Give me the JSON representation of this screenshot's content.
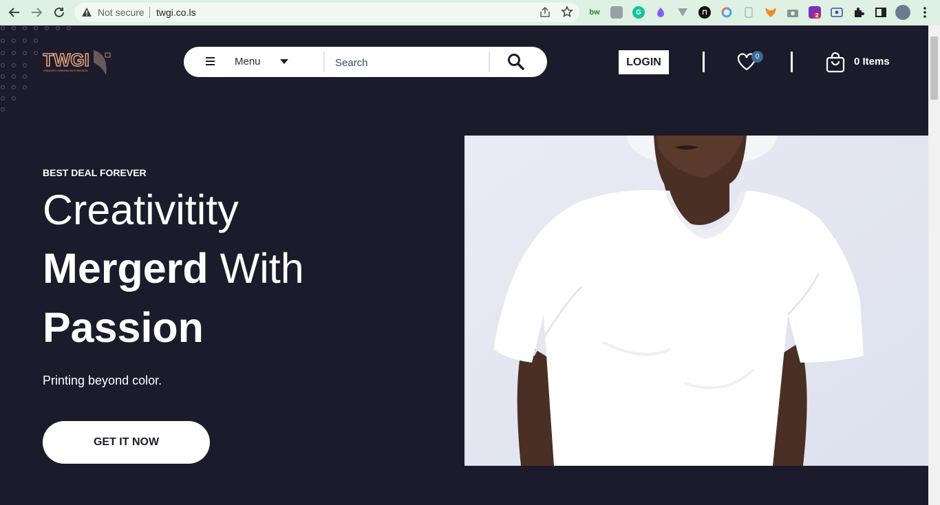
{
  "browser": {
    "security_label": "Not secure",
    "url": "twgi.co.ls",
    "extensions": [
      "bw-icon",
      "chart-ext-icon",
      "grammarly-icon",
      "color-ext-icon",
      "v-ext-icon",
      "dark-ext-icon",
      "rainbow-ext-icon",
      "phone-ext-icon",
      "fox-ext-icon",
      "camera-ext-icon",
      "tag-ext-icon",
      "screen-ext-icon",
      "puzzle-icon",
      "sidebar-icon",
      "profile-avatar",
      "more-icon"
    ],
    "ext_badge": "2"
  },
  "header": {
    "logo_text": "TWGI",
    "logo_tagline": "CREATIVITY MERGED WITH PASSION",
    "menu_label": "Menu",
    "search_placeholder": "Search",
    "login_label": "LOGIN",
    "wishlist_count": "0",
    "cart_label": "0 Items"
  },
  "hero": {
    "kicker": "BEST DEAL FOREVER",
    "line1": "Creativitity",
    "line2_bold": "Mergerd",
    "line2_light": " With",
    "line3": "Passion",
    "subtitle": "Printing beyond color.",
    "cta_label": "GET IT NOW"
  },
  "colors": {
    "page_bg": "#1c1b2b",
    "brand": "#e8a27d",
    "chrome_bg": "#dff1e2"
  }
}
